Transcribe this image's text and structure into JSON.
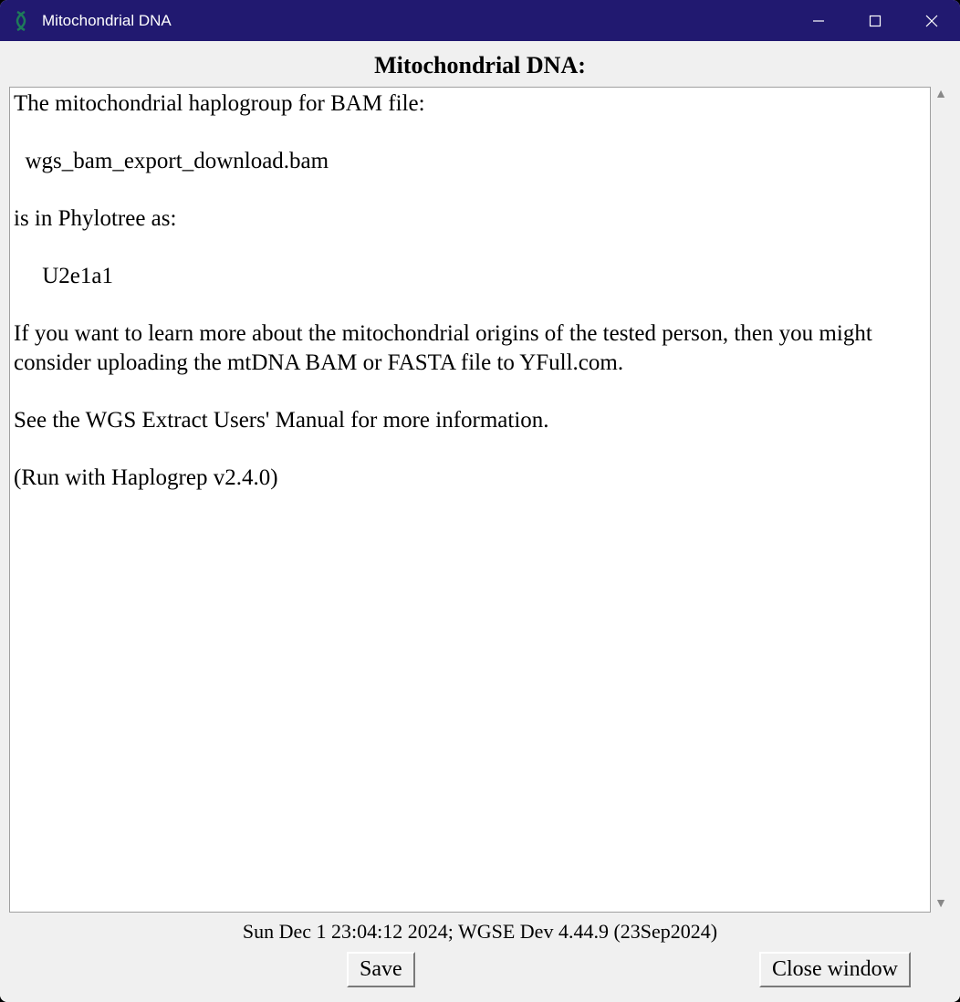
{
  "titlebar": {
    "title": "Mitochondrial DNA",
    "icon_name": "dna-helix-icon"
  },
  "heading": "Mitochondrial DNA:",
  "body_lines": [
    "The mitochondrial haplogroup for BAM file:",
    "",
    "  wgs_bam_export_download.bam",
    "",
    "is in Phylotree as:",
    "",
    "     U2e1a1",
    "",
    "If you want to learn more about the mitochondrial origins of the tested person, then you might consider uploading the mtDNA BAM or FASTA file to YFull.com.",
    "",
    "See the WGS Extract Users' Manual for more information.",
    "",
    "(Run with Haplogrep v2.4.0)"
  ],
  "bam_file": "wgs_bam_export_download.bam",
  "haplogroup": "U2e1a1",
  "haplogrep_version": "v2.4.0",
  "status": "Sun Dec  1 23:04:12 2024;  WGSE Dev 4.44.9 (23Sep2024)",
  "buttons": {
    "save": "Save",
    "close": "Close window"
  },
  "scroll": {
    "up": "▲",
    "down": "▼"
  }
}
